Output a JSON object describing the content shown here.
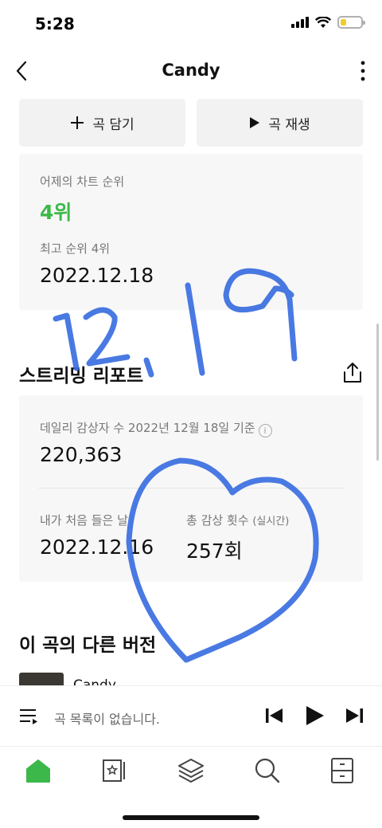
{
  "status_bar": {
    "time": "5:28",
    "battery_level": 0.3
  },
  "header": {
    "title": "Candy",
    "back_icon": "chevron-left-icon",
    "more_icon": "more-vertical-icon"
  },
  "actions": {
    "add_label": "곡 담기",
    "play_label": "곡 재생"
  },
  "chart": {
    "yesterday_label": "어제의 차트 순위",
    "yesterday_rank": "4위",
    "best_label": "최고 순위 4위",
    "best_date": "2022.12.18"
  },
  "report": {
    "title": "스트리밍 리포트",
    "daily_label": "데일리 감상자 수 2022년 12월 18일 기준",
    "daily_value": "220,363",
    "first_listen_label": "내가 처음 들은 날",
    "first_listen_value": "2022.12.16",
    "total_label": "총 감상 횟수",
    "total_label_suffix": "(실시간)",
    "total_value": "257회",
    "info_glyph": "i"
  },
  "versions": {
    "title": "이 곡의 다른 버전",
    "items": [
      {
        "name": "Candy"
      }
    ]
  },
  "player": {
    "empty_text": "곡 목록이 없습니다."
  },
  "nav": {
    "items": [
      {
        "icon": "home-icon",
        "active": true
      },
      {
        "icon": "library-icon",
        "active": false
      },
      {
        "icon": "layers-icon",
        "active": false
      },
      {
        "icon": "search-icon",
        "active": false
      },
      {
        "icon": "storage-icon",
        "active": false
      }
    ]
  },
  "colors": {
    "accent": "#3cb84a",
    "annotation": "#3a6ee0",
    "battery": "#f2cc2f"
  },
  "annotations": {
    "handwritten_date": "12.19"
  }
}
